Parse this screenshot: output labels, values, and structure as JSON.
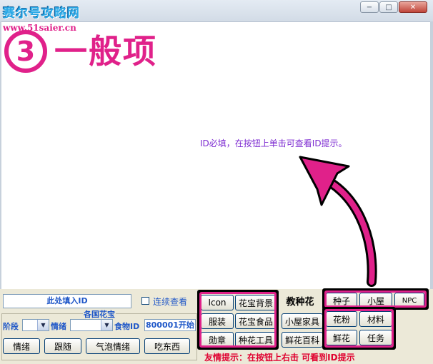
{
  "window": {
    "logo_text": "赛尔号攻略网",
    "logo_url": "www.51saier.cn",
    "minimize_glyph": "−",
    "maximize_glyph": "□",
    "close_glyph": "✕"
  },
  "heading": {
    "number": "3",
    "title": "一般项"
  },
  "annotation": "ID必填，在按钮上单击可查看ID提示。",
  "form": {
    "id_input_value": "此处填入ID",
    "continuous_view_label": "连续查看",
    "group_title": "各国花宝",
    "stage_label": "阶段",
    "mood_label": "情绪",
    "food_id_label": "食物ID",
    "food_id_hint": "800001开始"
  },
  "action_buttons": [
    "情绪",
    "跟随",
    "气泡情绪",
    "吃东西"
  ],
  "tabs": {
    "row1": [
      "Icon",
      "花宝背景",
      "教种花",
      "种子",
      "小屋",
      "NPC"
    ],
    "row2": [
      "服装",
      "花宝食品",
      "小屋家具",
      "花粉",
      "材料"
    ],
    "row3": [
      "勋章",
      "种花工具",
      "鲜花百科",
      "鲜花",
      "任务"
    ]
  },
  "footer_hint": "友情提示：在按钮上右击 可看到ID提示",
  "colors": {
    "accent_pink": "#e0218a",
    "annotation_purple": "#7d2bd1",
    "label_blue": "#1f57c8",
    "hint_red": "#e0002f"
  }
}
